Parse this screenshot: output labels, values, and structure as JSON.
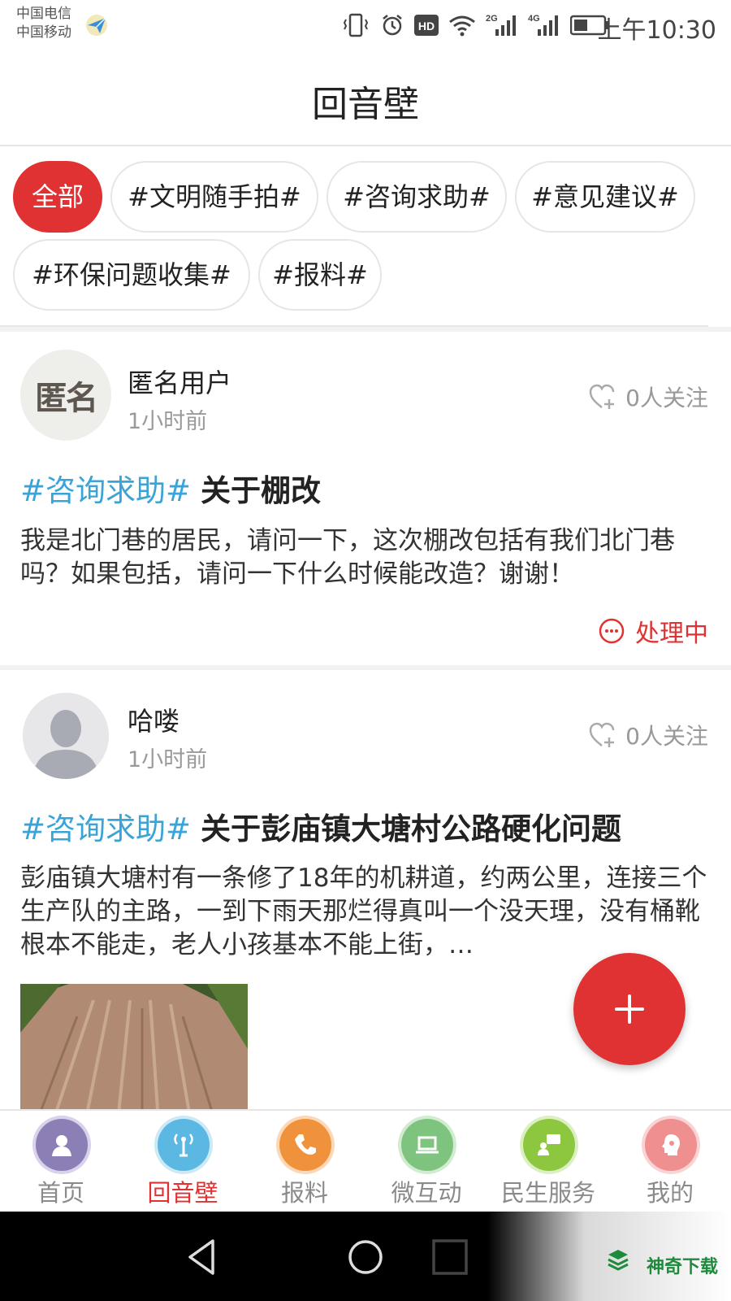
{
  "status_bar": {
    "carrier_1": "中国电信",
    "carrier_2": "中国移动",
    "time": "上午10:30",
    "icons": [
      "vibrate-icon",
      "alarm-icon",
      "hd-icon",
      "wifi-icon",
      "signal-2g-icon",
      "signal-4g-icon",
      "battery-icon"
    ],
    "net_2g": "2G",
    "net_4g": "4G",
    "hd": "HD"
  },
  "header": {
    "title": "回音壁"
  },
  "tags": [
    {
      "label": "全部",
      "active": true
    },
    {
      "label": "#文明随手拍#",
      "active": false
    },
    {
      "label": "#咨询求助#",
      "active": false
    },
    {
      "label": "#意见建议#",
      "active": false
    },
    {
      "label": "#环保问题收集#",
      "active": false
    },
    {
      "label": "#报料#",
      "active": false
    }
  ],
  "posts": [
    {
      "avatar_text": "匿名",
      "username": "匿名用户",
      "time": "1小时前",
      "follow": "0人关注",
      "hashtag": "#咨询求助#",
      "title": "关于棚改",
      "body": "我是北门巷的居民，请问一下，这次棚改包括有我们北门巷吗？如果包括，请问一下什么时候能改造？谢谢！",
      "status": "处理中"
    },
    {
      "username": "哈喽",
      "time": "1小时前",
      "follow": "0人关注",
      "hashtag": "#咨询求助#",
      "title": "关于彭庙镇大塘村公路硬化问题",
      "body": "彭庙镇大塘村有一条修了18年的机耕道，约两公里，连接三个生产队的主路，一到下雨天那烂得真叫一个没天理，没有桶靴根本不能走，老人小孩基本不能上街，…"
    }
  ],
  "bottom_nav": [
    {
      "label": "首页",
      "icon": "home-icon",
      "color": "#8c7fb5",
      "active": false
    },
    {
      "label": "回音壁",
      "icon": "echo-wall-icon",
      "color": "#5bb8e2",
      "active": true
    },
    {
      "label": "报料",
      "icon": "phone-icon",
      "color": "#f0923b",
      "active": false
    },
    {
      "label": "微互动",
      "icon": "laptop-icon",
      "color": "#7ec47f",
      "active": false
    },
    {
      "label": "民生服务",
      "icon": "service-icon",
      "color": "#8dc63f",
      "active": false
    },
    {
      "label": "我的",
      "icon": "profile-icon",
      "color": "#ef8f8f",
      "active": false
    }
  ],
  "watermark": "神奇下载",
  "colors": {
    "accent": "#e03232",
    "hashtag": "#3aa3d8"
  }
}
